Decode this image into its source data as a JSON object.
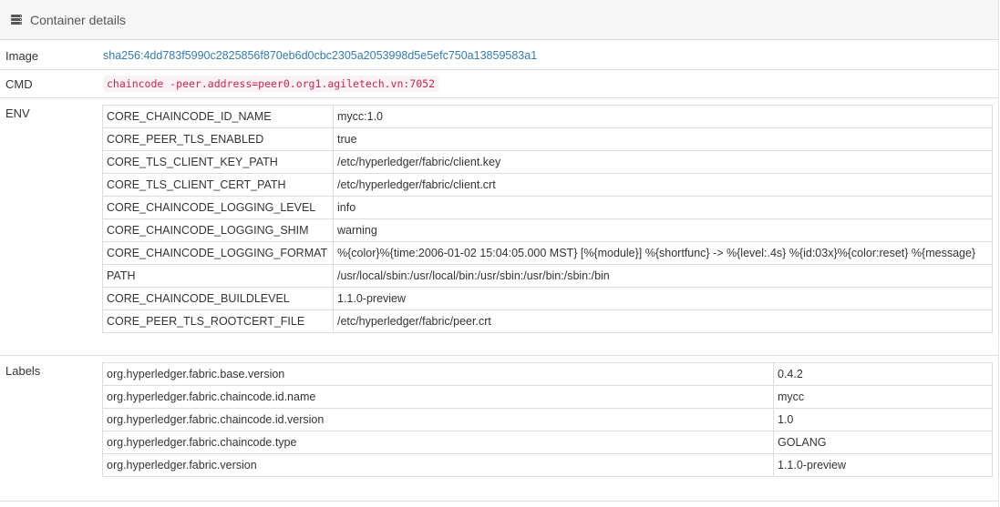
{
  "header": {
    "icon": "server-icon",
    "title": "Container details"
  },
  "image": {
    "label": "Image",
    "value": "sha256:4dd783f5990c2825856f870eb6d0cbc2305a2053998d5e5efc750a13859583a1"
  },
  "cmd": {
    "label": "CMD",
    "value": "chaincode -peer.address=peer0.org1.agiletech.vn:7052"
  },
  "env": {
    "label": "ENV",
    "rows": [
      {
        "key": "CORE_CHAINCODE_ID_NAME",
        "value": "mycc:1.0"
      },
      {
        "key": "CORE_PEER_TLS_ENABLED",
        "value": "true"
      },
      {
        "key": "CORE_TLS_CLIENT_KEY_PATH",
        "value": "/etc/hyperledger/fabric/client.key"
      },
      {
        "key": "CORE_TLS_CLIENT_CERT_PATH",
        "value": "/etc/hyperledger/fabric/client.crt"
      },
      {
        "key": "CORE_CHAINCODE_LOGGING_LEVEL",
        "value": "info"
      },
      {
        "key": "CORE_CHAINCODE_LOGGING_SHIM",
        "value": "warning"
      },
      {
        "key": "CORE_CHAINCODE_LOGGING_FORMAT",
        "value": "%{color}%{time:2006-01-02 15:04:05.000 MST} [%{module}] %{shortfunc} -> %{level:.4s} %{id:03x}%{color:reset} %{message}"
      },
      {
        "key": "PATH",
        "value": "/usr/local/sbin:/usr/local/bin:/usr/sbin:/usr/bin:/sbin:/bin"
      },
      {
        "key": "CORE_CHAINCODE_BUILDLEVEL",
        "value": "1.1.0-preview"
      },
      {
        "key": "CORE_PEER_TLS_ROOTCERT_FILE",
        "value": "/etc/hyperledger/fabric/peer.crt"
      }
    ]
  },
  "labels": {
    "label": "Labels",
    "rows": [
      {
        "key": "org.hyperledger.fabric.base.version",
        "value": "0.4.2"
      },
      {
        "key": "org.hyperledger.fabric.chaincode.id.name",
        "value": "mycc"
      },
      {
        "key": "org.hyperledger.fabric.chaincode.id.version",
        "value": "1.0"
      },
      {
        "key": "org.hyperledger.fabric.chaincode.type",
        "value": "GOLANG"
      },
      {
        "key": "org.hyperledger.fabric.version",
        "value": "1.1.0-preview"
      }
    ]
  }
}
